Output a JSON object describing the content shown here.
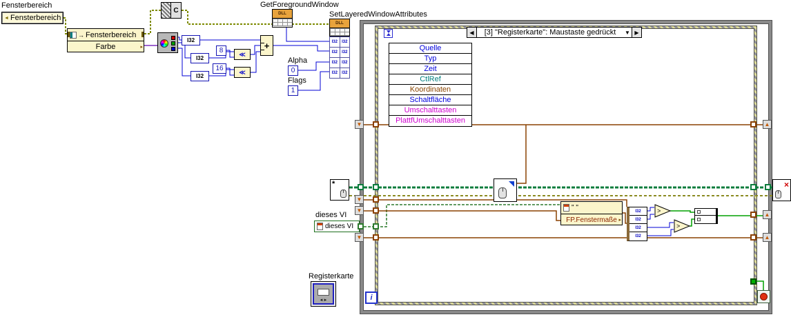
{
  "colors": {
    "wire_integer": "#0000d6",
    "wire_cluster": "#8a4000",
    "wire_vi_refnum": "#2d7a2d",
    "wire_pane_refnum": "#7d8a00",
    "wire_event_registration": "#0c7c3c",
    "wire_error": "#8a8a20",
    "wire_boolean": "#00a000",
    "wire_color_value": "#7b2fbe",
    "node_fill": "#fbf5cb",
    "loop_border": "#8a8a8a",
    "stop_button": "#e03010"
  },
  "icons": {
    "prev": "◀",
    "next": "▶",
    "dropdown": "▼",
    "shift_left": "≪",
    "add": "+",
    "asterisk": "*",
    "close_x": "×",
    "output_arrow": "▸",
    "ref_arrow": "→",
    "pane_glyph": "◄",
    "tab_arrows": "◄►",
    "tunnel_down": "▼",
    "tunnel_up": "▲"
  },
  "top_left": {
    "pane_label": "Fensterbereich",
    "pane_terminal_label": "Fensterbereich",
    "property_node": {
      "row1": "Fensterbereich",
      "row2": "Farbe"
    },
    "cast_letter": "C",
    "i32_label": "I32",
    "const_8": "8",
    "const_16": "16"
  },
  "winapi": {
    "get_foreground_window_label": "GetForegroundWindow",
    "set_layered_window_attributes_label": "SetLayeredWindowAttributes",
    "dll_text": "DLL",
    "terminal_cells": [
      "I32",
      "I32",
      "I32",
      "I32",
      "I32",
      "I32",
      "I32",
      "I32"
    ],
    "alpha_label": "Alpha",
    "alpha_value": "0",
    "flags_label": "Flags",
    "flags_value": "1"
  },
  "references": {
    "vi_ref_label": "dieses VI",
    "vi_ref_value": "dieses VI",
    "tab_label": "Registerkarte"
  },
  "while_loop": {
    "iteration_symbol": "i"
  },
  "event_structure": {
    "selector": {
      "label": "[3] \"Registerkarte\": Maustaste gedrückt"
    },
    "event_data": [
      {
        "label": "Quelle",
        "color": "#0000dc"
      },
      {
        "label": "Typ",
        "color": "#0000dc"
      },
      {
        "label": "Zeit",
        "color": "#0000dc"
      },
      {
        "label": "CtlRef",
        "color": "#007d7d"
      },
      {
        "label": "Koordinaten",
        "color": "#8a4500"
      },
      {
        "label": "Schaltfläche",
        "color": "#0000dc"
      },
      {
        "label": "Umschalttasten",
        "color": "#cf00cf"
      },
      {
        "label": "PlattfUmschalttasten",
        "color": "#cf00cf"
      }
    ],
    "fp_property_node": {
      "class_row": "\" \"",
      "row": "FP.Fenstermaße"
    },
    "unbundle_cells": [
      "I32",
      "I32",
      "I32",
      "I32"
    ]
  }
}
